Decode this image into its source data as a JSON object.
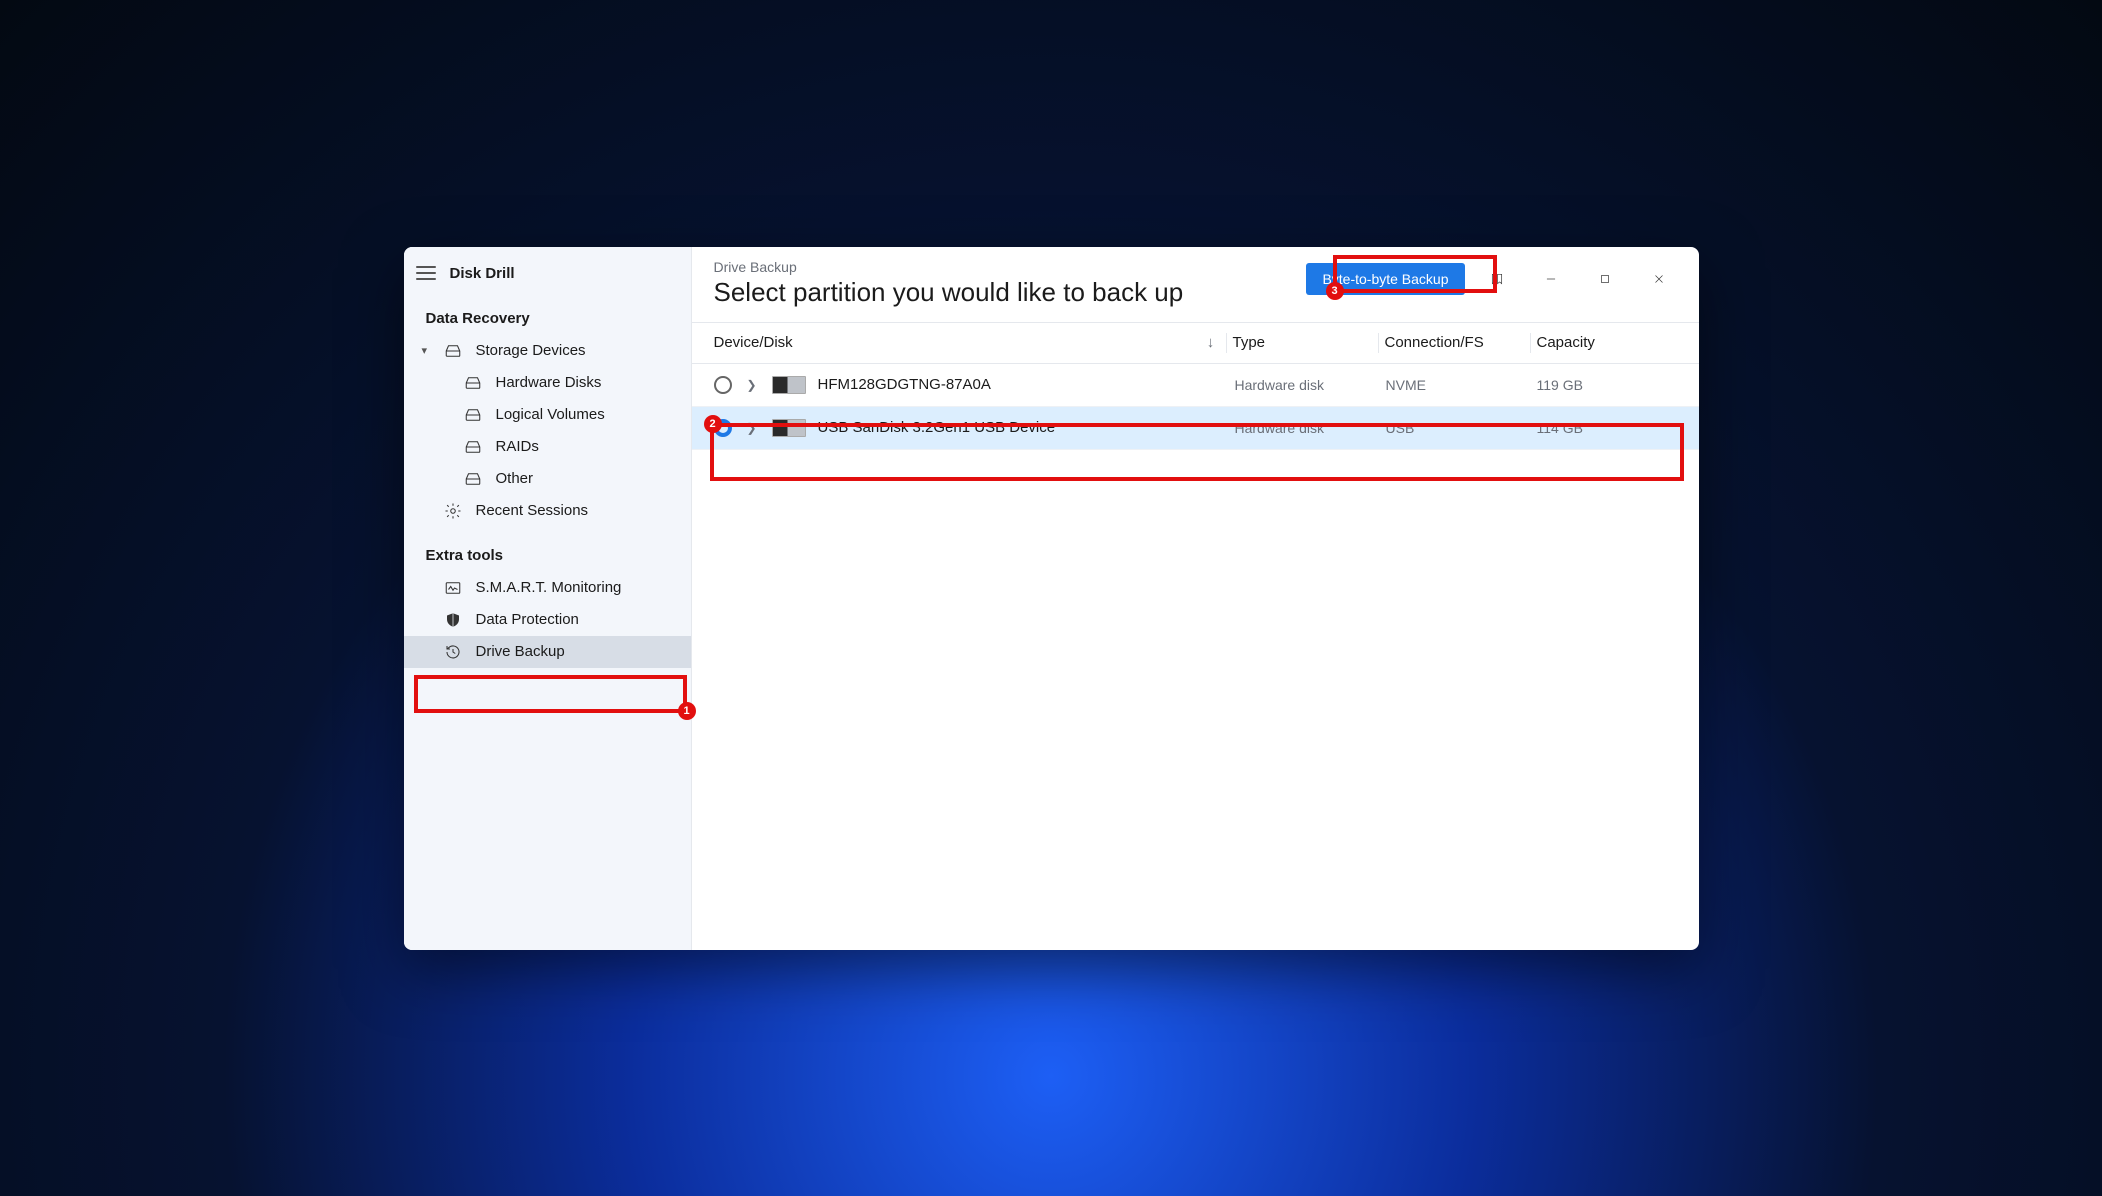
{
  "app": {
    "title": "Disk Drill"
  },
  "sidebar": {
    "sections": [
      {
        "heading": "Data Recovery",
        "items": [
          {
            "label": "Storage Devices",
            "expandable": true
          },
          {
            "label": "Hardware Disks"
          },
          {
            "label": "Logical Volumes"
          },
          {
            "label": "RAIDs"
          },
          {
            "label": "Other"
          },
          {
            "label": "Recent Sessions"
          }
        ]
      },
      {
        "heading": "Extra tools",
        "items": [
          {
            "label": "S.M.A.R.T. Monitoring"
          },
          {
            "label": "Data Protection"
          },
          {
            "label": "Drive Backup",
            "selected": true
          }
        ]
      }
    ]
  },
  "header": {
    "breadcrumb": "Drive Backup",
    "title": "Select partition you would like to back up",
    "primary_button": "Byte-to-byte Backup"
  },
  "table": {
    "columns": {
      "device": "Device/Disk",
      "type": "Type",
      "connection": "Connection/FS",
      "capacity": "Capacity"
    },
    "sort_indicator": "↓",
    "rows": [
      {
        "name": "HFM128GDGTNG-87A0A",
        "type": "Hardware disk",
        "connection": "NVME",
        "capacity": "119 GB",
        "selected": false
      },
      {
        "name": "USB  SanDisk 3.2Gen1 USB Device",
        "type": "Hardware disk",
        "connection": "USB",
        "capacity": "114 GB",
        "selected": true
      }
    ]
  },
  "callouts": {
    "c1": "1",
    "c2": "2",
    "c3": "3"
  }
}
